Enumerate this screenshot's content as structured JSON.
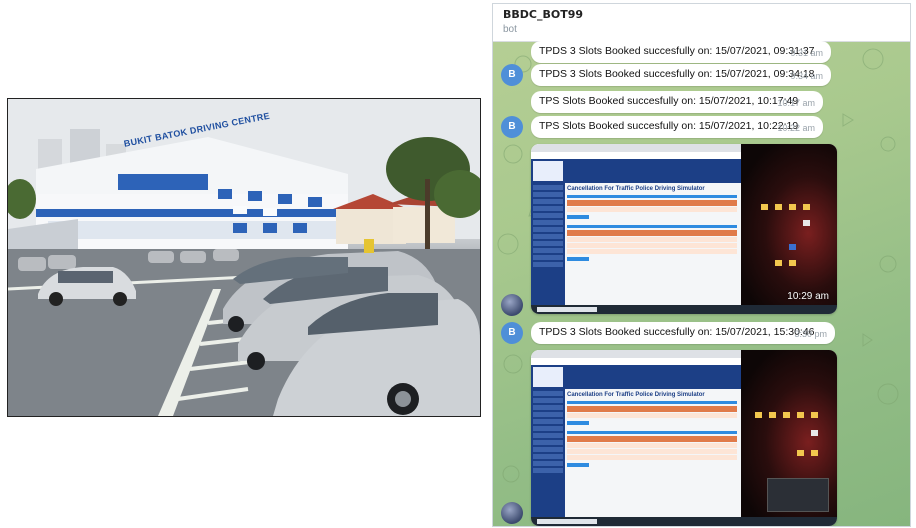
{
  "photo": {
    "building_sign": "BUKIT BATOK DRIVING CENTRE"
  },
  "chat": {
    "title": "BBDC_BOT99",
    "subtitle": "bot",
    "avatar_letter": "B",
    "messages": [
      {
        "text": "TPDS 3 Slots Booked succesfully on: 15/07/2021, 09:31:37",
        "time": "9:31 am"
      },
      {
        "text": "TPDS 3 Slots Booked succesfully on: 15/07/2021, 09:34:18",
        "time": "9:34 am"
      },
      {
        "text": "TPS Slots Booked succesfully on: 15/07/2021, 10:17:49",
        "time": "10:17 am"
      },
      {
        "text": "TPS Slots Booked succesfully on: 15/07/2021, 10:22:19",
        "time": "10:22 am"
      },
      {
        "text": "TPDS 3 Slots Booked succesfully on: 15/07/2021, 15:30:46",
        "time": "3:30 pm"
      }
    ],
    "screenshots": [
      {
        "time": "10:29 am",
        "page_title": "Cancellation For Traffic Police Driving Simulator"
      },
      {
        "time": "",
        "page_title": "Cancellation For Traffic Police Driving Simulator"
      }
    ]
  },
  "colors": {
    "avatar": "#4f8fd8",
    "site_blue": "#1c3f86",
    "table_header": "#e07b4a"
  }
}
